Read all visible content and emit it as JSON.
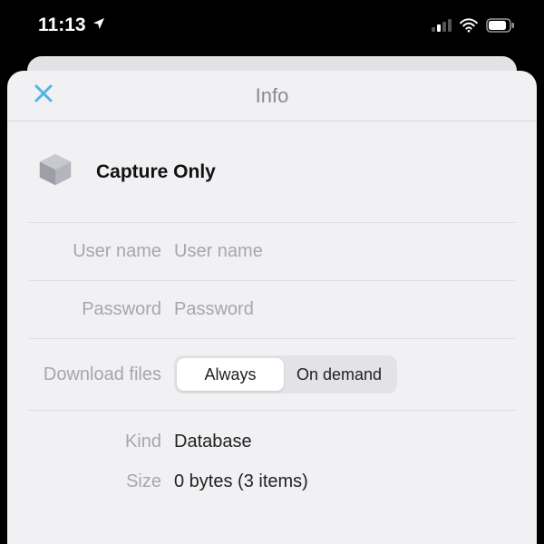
{
  "status": {
    "time": "11:13"
  },
  "nav": {
    "title": "Info"
  },
  "db": {
    "name": "Capture Only"
  },
  "fields": {
    "username_label": "User name",
    "username_placeholder": "User name",
    "username_value": "",
    "password_label": "Password",
    "password_placeholder": "Password",
    "password_value": "",
    "download_label": "Download files",
    "seg_always": "Always",
    "seg_on_demand": "On demand"
  },
  "info": {
    "kind_label": "Kind",
    "kind_value": "Database",
    "size_label": "Size",
    "size_value": "0 bytes (3 items)"
  }
}
